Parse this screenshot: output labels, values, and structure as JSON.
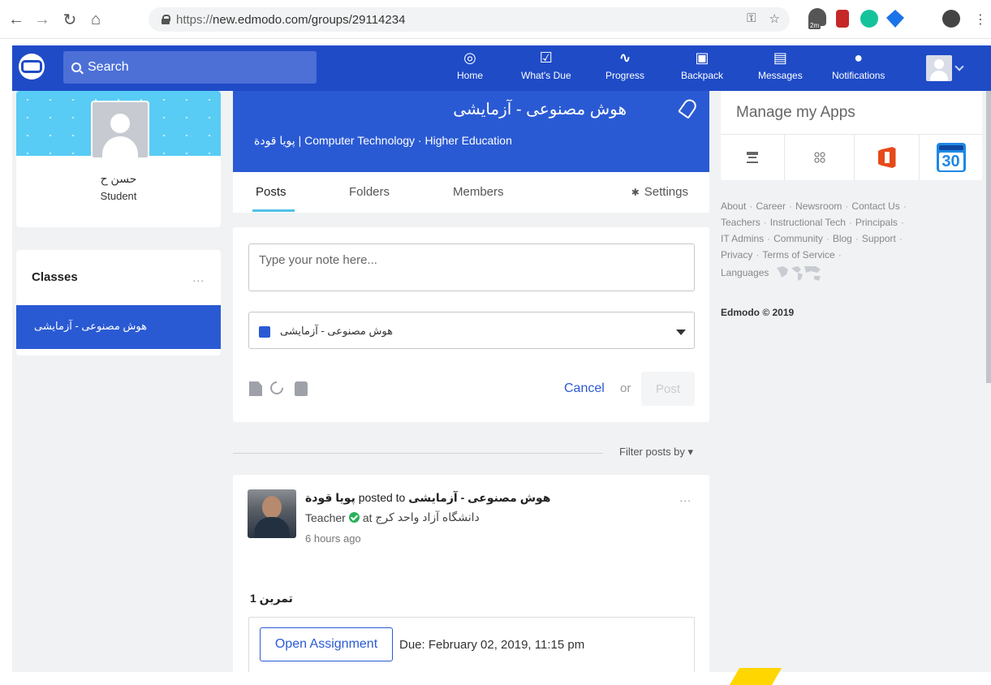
{
  "browser": {
    "url_scheme": "https://",
    "url_rest": "new.edmodo.com/groups/29114234",
    "ext_badge": "2m"
  },
  "topbar": {
    "search_placeholder": "Search",
    "nav": [
      {
        "label": "Home",
        "icon": "home-icon"
      },
      {
        "label": "What's Due",
        "icon": "calendar-check-icon"
      },
      {
        "label": "Progress",
        "icon": "pulse-icon"
      },
      {
        "label": "Backpack",
        "icon": "backpack-icon"
      },
      {
        "label": "Messages",
        "icon": "message-icon"
      },
      {
        "label": "Notifications",
        "icon": "bell-icon"
      }
    ]
  },
  "profile": {
    "name": "حسن ح",
    "role": "Student"
  },
  "classes": {
    "title": "Classes",
    "more": "...",
    "items": [
      "هوش مصنوعی - آزمایشی"
    ]
  },
  "group": {
    "title": "هوش مصنوعی - آزمایشی",
    "owner": "پویا قودة",
    "subtitle_rest": " | Computer Technology · Higher Education",
    "tabs": [
      "Posts",
      "Folders",
      "Members"
    ],
    "settings": "Settings"
  },
  "composer": {
    "placeholder": "Type your note here...",
    "recipient": "هوش مصنوعی - آزمایشی",
    "cancel": "Cancel",
    "or": "or",
    "post": "Post"
  },
  "filter": {
    "label": "Filter posts by ▾"
  },
  "post": {
    "group": "هوش مصنوعی - آزمایشی",
    "posted_to": " posted to ",
    "author": "پویا قودة",
    "role": "Teacher",
    "at": "at",
    "school": "دانشگاه آزاد واحد کرج",
    "time": "6 hours ago",
    "more": "...",
    "title": "تمرین 1",
    "open_label": "Open Assignment",
    "due": "Due: February 02, 2019, 11:15 pm"
  },
  "apps": {
    "title": "Manage my Apps",
    "calendar_day": "30"
  },
  "footer": {
    "links": [
      "About",
      "Career",
      "Newsroom",
      "Contact Us",
      "Teachers",
      "Instructional Tech",
      "Principals",
      "IT Admins",
      "Community",
      "Blog",
      "Support",
      "Privacy",
      "Terms of Service"
    ],
    "languages": "Languages",
    "copyright": "Edmodo © 2019"
  },
  "colors": {
    "brand": "#1f4bc7",
    "accent": "#2a5ad3",
    "tab_underline": "#4fc1e9"
  }
}
